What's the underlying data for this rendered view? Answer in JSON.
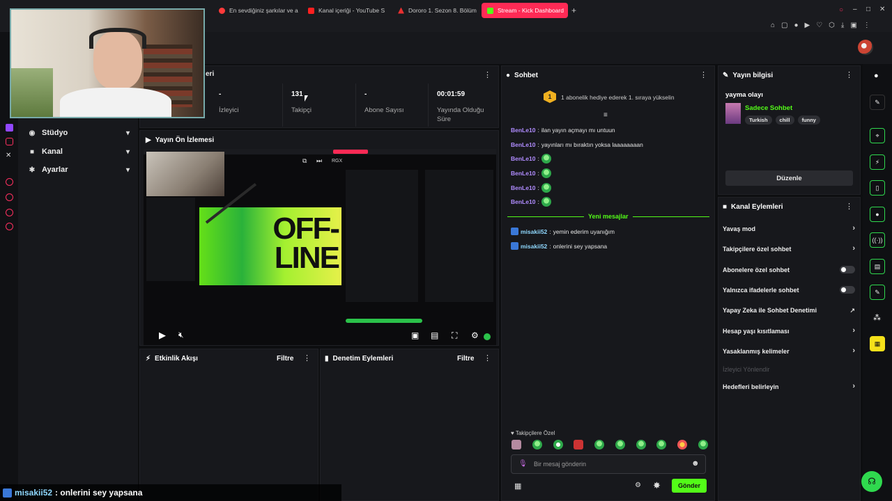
{
  "tabs": [
    {
      "label": "En sevdiğiniz şarkılar ve a",
      "color": "#ff3a3a"
    },
    {
      "label": "Kanal içeriği - YouTube S",
      "color": "#ff2020"
    },
    {
      "label": "Dororo 1. Sezon 8. Bölüm",
      "color": "#e83030"
    },
    {
      "label": "Stream - Kick Dashboard",
      "color": "#53fc18"
    }
  ],
  "sidebar": {
    "items": [
      {
        "label": "Stüdyo",
        "icon": "studio-icon"
      },
      {
        "label": "Kanal",
        "icon": "channel-icon"
      },
      {
        "label": "Ayarlar",
        "icon": "settings-icon"
      }
    ]
  },
  "stats": {
    "partial_title": "eri",
    "viewers": {
      "value": "-",
      "label": "İzleyici"
    },
    "followers": {
      "value": "131",
      "label": "Takipçi"
    },
    "subs": {
      "value": "-",
      "label": "Abone Sayısı"
    },
    "uptime": {
      "value": "00:01:59",
      "label": "Yayında Olduğu Süre"
    }
  },
  "preview": {
    "title": "Yayın Ön İzlemesi",
    "offline_text": "OFF-LINE",
    "overlay_label": "RGX"
  },
  "activity": {
    "title": "Etkinlik Akışı",
    "filter": "Filtre"
  },
  "moderation": {
    "title": "Denetim Eylemleri",
    "filter": "Filtre"
  },
  "chat": {
    "title": "Sohbet",
    "pinned": "1 abonelik hediye ederek 1. sıraya yükselin",
    "pinned_rank": "1",
    "messages": [
      {
        "user": "BenLe10",
        "text": "ilan yayın açmayı mı untuun"
      },
      {
        "user": "BenLe10",
        "text": "yayınları mı bıraktın yoksa laaaaaaaan"
      },
      {
        "user": "BenLe10",
        "text": ""
      },
      {
        "user": "BenLe10",
        "text": ""
      },
      {
        "user": "BenLe10",
        "text": ""
      },
      {
        "user": "BenLe10",
        "text": ""
      }
    ],
    "new_messages": "Yeni mesajlar",
    "new_messages_list": [
      {
        "user": "misakii52",
        "text": "yemin ederim uyanığım"
      },
      {
        "user": "misakii52",
        "text": "onlerini sey yapsana"
      }
    ],
    "followers_only": "Takipçilere Özel",
    "input_placeholder": "Bir mesaj gönderin",
    "send_label": "Gönder"
  },
  "stream_info": {
    "title": "Yayın bilgisi",
    "event": "yayma olayı",
    "category": "Sadece Sohbet",
    "tags": [
      "Turkish",
      "chill",
      "funny"
    ],
    "edit_label": "Düzenle"
  },
  "channel_actions": {
    "title": "Kanal Eylemleri",
    "items": [
      {
        "label": "Yavaş mod",
        "control": "chevron"
      },
      {
        "label": "Takipçilere özel sohbet",
        "control": "chevron"
      },
      {
        "label": "Abonelere özel sohbet",
        "control": "toggle"
      },
      {
        "label": "Yalnızca ifadelerle sohbet",
        "control": "toggle"
      },
      {
        "label": "Yapay Zeka ile Sohbet Denetimi",
        "control": "external"
      },
      {
        "label": "Hesap yaşı kısıtlaması",
        "control": "chevron"
      },
      {
        "label": "Yasaklanmış kelimeler",
        "control": "chevron"
      },
      {
        "label": "İzleyici Yönlendir",
        "control": "none",
        "disabled": true
      },
      {
        "label": "Hedefleri belirleyin",
        "control": "chevron"
      }
    ]
  },
  "caption": {
    "user": "misakii52",
    "text": ": onlerini sey yapsana"
  },
  "colors": {
    "accent": "#53fc18",
    "brand_pink": "#ff2a55",
    "panel": "#17181c",
    "chat_user": "#b08cff"
  }
}
